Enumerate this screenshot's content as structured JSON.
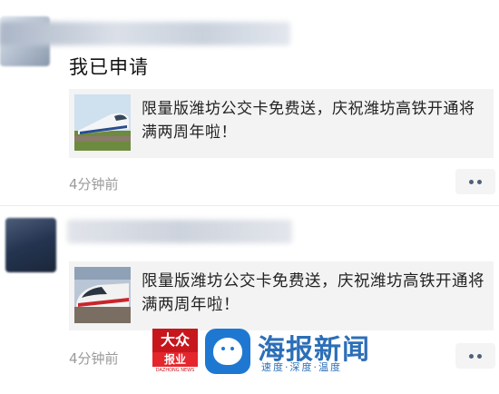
{
  "posts": [
    {
      "comment": "我已申请",
      "shared_card": {
        "title": "限量版潍坊公交卡免费送，庆祝潍坊高铁开通将满两周年啦！",
        "thumbnail_icon": "high-speed-train-photo"
      },
      "time": "4分钟前"
    },
    {
      "shared_card": {
        "title": "限量版潍坊公交卡免费送，庆祝潍坊高铁开通将满两周年啦！",
        "thumbnail_icon": "high-speed-train-photo"
      },
      "time": "4分钟前"
    }
  ],
  "watermark": {
    "logo_top": "大众",
    "logo_middle": "报业",
    "logo_bottom": "DAZHONG NEWS",
    "brand_name": "海报新闻",
    "brand_slogan": "速度·深度·温度"
  },
  "colors": {
    "card_bg": "#f3f3f3",
    "time_text": "#9a9a9a",
    "more_dots": "#50607a",
    "brand_blue": "#2c6fb8",
    "dazhong_red": "#c8161d"
  }
}
